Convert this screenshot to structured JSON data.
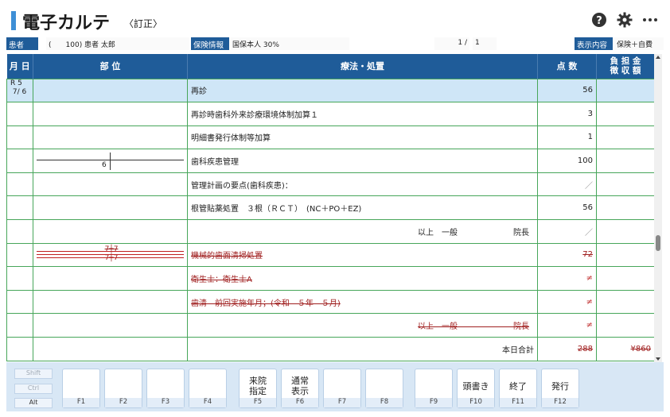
{
  "header": {
    "title": "電子カルテ",
    "subtitle": "〈訂正〉",
    "help_icon": "help-circle-icon",
    "settings_icon": "gear-icon",
    "more_icon": "more-dots-icon"
  },
  "patient": {
    "label": "患者",
    "value": "(　　100) 患者 太郎",
    "insurance_label": "保険情報",
    "insurance_value": "国保本人 30%",
    "page_current": "1 /",
    "page_total": "1",
    "display_label": "表示内容",
    "display_value": "保険＋自費"
  },
  "table": {
    "headers": {
      "date": "月 日",
      "site": "部 位",
      "treatment": "療法・処置",
      "points": "点 数",
      "burden": "負 担 金\n徴 収 額"
    },
    "rows": [
      {
        "date": "R 5\n 7/ 6",
        "site": "",
        "treatment": "再診",
        "points": "56",
        "burden": ""
      },
      {
        "date": "",
        "site": "",
        "treatment": "再診時歯科外来診療環境体制加算１",
        "points": "3",
        "burden": ""
      },
      {
        "date": "",
        "site": "",
        "treatment": "明細書発行体制等加算",
        "points": "1",
        "burden": ""
      },
      {
        "date": "",
        "site": "6",
        "treatment": "歯科疾患管理",
        "points": "100",
        "burden": ""
      },
      {
        "date": "",
        "site": "",
        "treatment": "管理計画の要点(歯科疾患)：",
        "points": "／",
        "burden": ""
      },
      {
        "date": "",
        "site": "",
        "treatment": "根管貼薬処置　３根（ＲＣＴ）　(NC＋PO＋EZ)",
        "points": "56",
        "burden": ""
      },
      {
        "date": "",
        "site": "",
        "treatment": "以上　一般　　　　　　　院長",
        "points": "／",
        "burden": ""
      },
      {
        "date": "",
        "site": "7┼7\n7┼7",
        "treatment": "機械的歯面清掃処置",
        "points": "72",
        "burden": ""
      },
      {
        "date": "",
        "site": "",
        "treatment": "衛生士：衛生士A",
        "points": "≠",
        "burden": ""
      },
      {
        "date": "",
        "site": "",
        "treatment": "歯清　前回実施年月；(令和　５年　５月)",
        "points": "≠",
        "burden": ""
      },
      {
        "date": "",
        "site": "",
        "treatment": "以上　一般　　　　　　　院長",
        "points": "≠",
        "burden": ""
      },
      {
        "date": "",
        "site": "",
        "treatment": "本日合計",
        "points": "288",
        "burden": "¥860"
      }
    ]
  },
  "function_keys": {
    "mods": [
      "Shift",
      "Ctrl",
      "Alt"
    ],
    "keys": [
      {
        "label": "",
        "num": "F1"
      },
      {
        "label": "",
        "num": "F2"
      },
      {
        "label": "",
        "num": "F3"
      },
      {
        "label": "",
        "num": "F4"
      },
      {
        "label": "来院\n指定",
        "num": "F5"
      },
      {
        "label": "通常\n表示",
        "num": "F6"
      },
      {
        "label": "",
        "num": "F7"
      },
      {
        "label": "",
        "num": "F8"
      },
      {
        "label": "",
        "num": "F9"
      },
      {
        "label": "頭書き",
        "num": "F10"
      },
      {
        "label": "終了",
        "num": "F11"
      },
      {
        "label": "発行",
        "num": "F12"
      }
    ]
  }
}
